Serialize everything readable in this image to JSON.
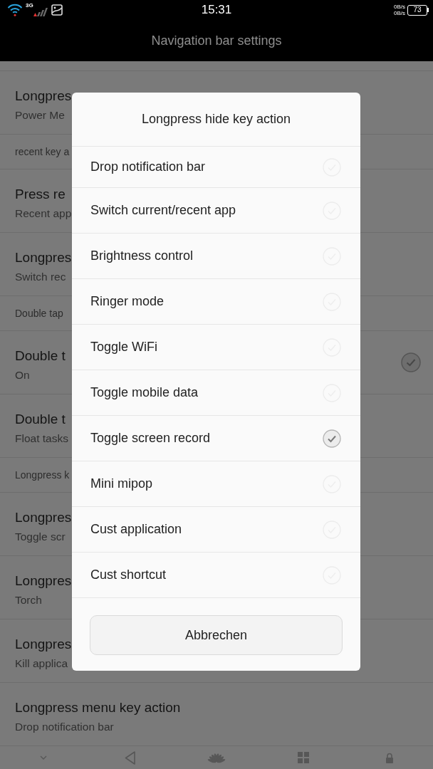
{
  "status_bar": {
    "network": "3G",
    "time": "15:31",
    "upload_speed": "0B/s",
    "download_speed": "0B/s",
    "battery": "73"
  },
  "app_bar": {
    "title": "Navigation bar settings"
  },
  "settings_list": [
    {
      "kind": "item",
      "title": "Longpres",
      "summary": "Power Me"
    },
    {
      "kind": "category",
      "title": "recent key a"
    },
    {
      "kind": "item",
      "title": "Press re",
      "summary": "Recent app"
    },
    {
      "kind": "item",
      "title": "Longpres",
      "summary": "Switch rec"
    },
    {
      "kind": "category",
      "title": "Double tap"
    },
    {
      "kind": "checkbox",
      "title": "Double t",
      "summary": "On",
      "checked": true
    },
    {
      "kind": "item",
      "title": "Double t",
      "summary": "Float tasks"
    },
    {
      "kind": "category",
      "title": "Longpress k"
    },
    {
      "kind": "item",
      "title": "Longpres",
      "summary": "Toggle scr"
    },
    {
      "kind": "item",
      "title": "Longpres",
      "summary": "Torch"
    },
    {
      "kind": "item",
      "title": "Longpres",
      "summary": "Kill applica"
    },
    {
      "kind": "item",
      "title": "Longpress menu key action",
      "summary": "Drop notification bar"
    }
  ],
  "dialog": {
    "title": "Longpress hide key action",
    "options": [
      {
        "label": "Drop notification bar",
        "selected": false
      },
      {
        "label": "Switch current/recent app",
        "selected": false
      },
      {
        "label": "Brightness control",
        "selected": false
      },
      {
        "label": "Ringer mode",
        "selected": false
      },
      {
        "label": "Toggle WiFi",
        "selected": false
      },
      {
        "label": "Toggle mobile data",
        "selected": false
      },
      {
        "label": "Toggle screen record",
        "selected": true
      },
      {
        "label": "Mini mipop",
        "selected": false
      },
      {
        "label": "Cust application",
        "selected": false
      },
      {
        "label": "Cust shortcut",
        "selected": false
      }
    ],
    "cancel_button": "Abbrechen"
  }
}
